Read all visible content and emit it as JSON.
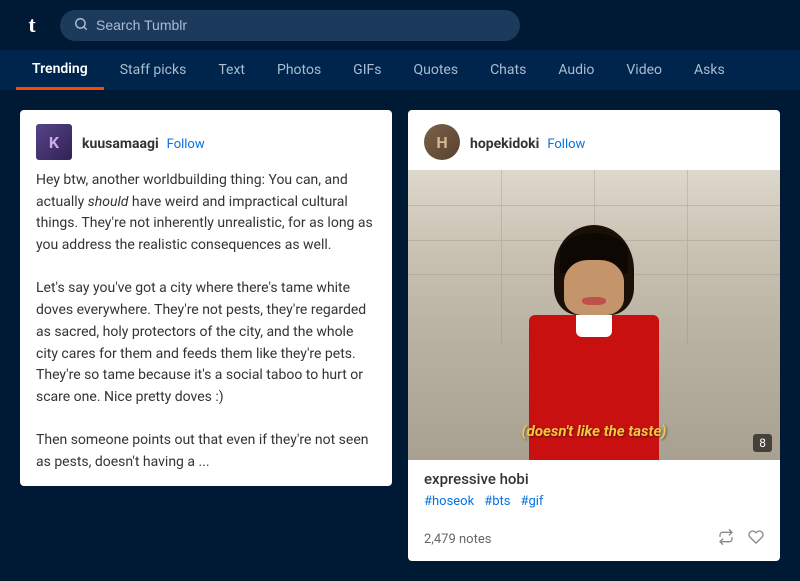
{
  "topbar": {
    "logo": "t",
    "search_placeholder": "Search Tumblr"
  },
  "secondary_nav": {
    "items": [
      {
        "label": "Trending",
        "active": true
      },
      {
        "label": "Staff picks",
        "active": false
      },
      {
        "label": "Text",
        "active": false
      },
      {
        "label": "Photos",
        "active": false
      },
      {
        "label": "GIFs",
        "active": false
      },
      {
        "label": "Quotes",
        "active": false
      },
      {
        "label": "Chats",
        "active": false
      },
      {
        "label": "Audio",
        "active": false
      },
      {
        "label": "Video",
        "active": false
      },
      {
        "label": "Asks",
        "active": false
      }
    ]
  },
  "posts": [
    {
      "id": "post1",
      "username": "kuusamaagi",
      "follow_label": "Follow",
      "text_parts": [
        {
          "type": "normal",
          "text": " Hey btw, another worldbuilding thing: You can, and actually "
        },
        {
          "type": "italic",
          "text": "should"
        },
        {
          "type": "normal",
          "text": " have weird and impractical cultural things. They're not inherently unrealistic, for as long as you address the realistic consequences as well."
        },
        {
          "type": "break"
        },
        {
          "type": "normal",
          "text": " Let's say you've got a city where there's tame white doves everywhere. They're not pests, they're regarded as sacred, holy protectors of the city, and the whole city cares for them and feeds them like they're pets. They're so tame because it's a social taboo to hurt or scare one. Nice pretty doves :)"
        },
        {
          "type": "break"
        },
        {
          "type": "normal",
          "text": " Then someone points out that even if they're not seen as pests, doesn't having a ..."
        }
      ]
    },
    {
      "id": "post2",
      "username": "hopekidoki",
      "follow_label": "Follow",
      "image_caption": "(doesn't like the taste)",
      "image_number": "8",
      "post_title": "expressive hobi",
      "tags": [
        "#hoseok",
        "#bts",
        "#gif"
      ],
      "notes": "2,479 notes"
    }
  ],
  "icons": {
    "search": "🔍",
    "reblog": "↺",
    "heart": "♡"
  }
}
